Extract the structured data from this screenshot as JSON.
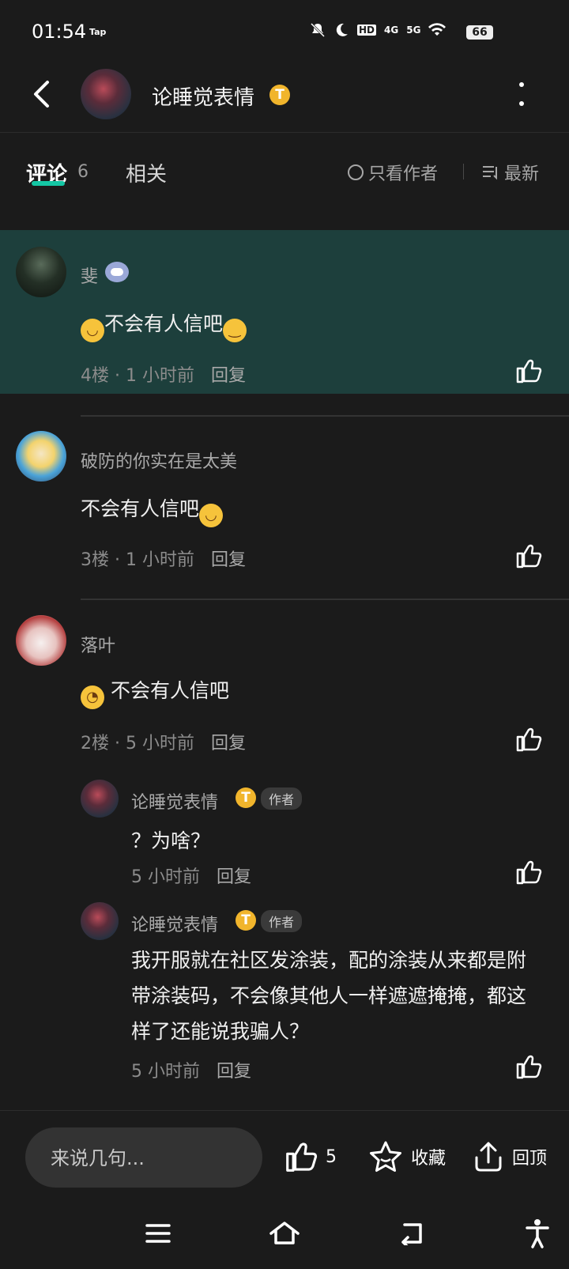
{
  "status_bar": {
    "time": "01:54",
    "app_label": "Tap",
    "icons": [
      "mute-icon",
      "moon-icon",
      "hd-icon",
      "4g-signal-icon",
      "5g-signal-icon",
      "wifi-icon"
    ],
    "hd": "HD",
    "sig_4g": "4G",
    "sig_5g": "5G",
    "battery": "66"
  },
  "header": {
    "title": "论睡觉表情",
    "badge": "T"
  },
  "tabs": {
    "comments_label": "评论",
    "comments_count": "6",
    "related_label": "相关",
    "author_only_label": "只看作者",
    "sort_label": "最新"
  },
  "comments": [
    {
      "name": "斐",
      "content": "不会有人信吧",
      "floor": "4楼",
      "time": "1 小时前",
      "reply": "回复"
    },
    {
      "name": "破防的你实在是太美",
      "content": "不会有人信吧",
      "floor": "3楼",
      "time": "1 小时前",
      "reply": "回复"
    },
    {
      "name": "落叶",
      "content": "不会有人信吧",
      "floor": "2楼",
      "time": "5 小时前",
      "reply": "回复",
      "replies": [
        {
          "name": "论睡觉表情",
          "badge": "T",
          "author_tag": "作者",
          "content": "？为啥？",
          "time": "5 小时前",
          "reply": "回复"
        },
        {
          "name": "论睡觉表情",
          "badge": "T",
          "author_tag": "作者",
          "content": "我开服就在社区发涂装，配的涂装从来都是附带涂装码，不会像其他人一样遮遮掩掩，都这样了还能说我骗人？",
          "time": "5 小时前",
          "reply": "回复"
        }
      ]
    }
  ],
  "bottom_bar": {
    "input_placeholder": "来说几句...",
    "like_count": "5",
    "collect_label": "收藏",
    "top_label": "回顶"
  },
  "colors": {
    "background": "#1b1b1b",
    "highlight": "#1d3f3c",
    "accent": "#14c6a4",
    "badge": "#f1b52c"
  }
}
